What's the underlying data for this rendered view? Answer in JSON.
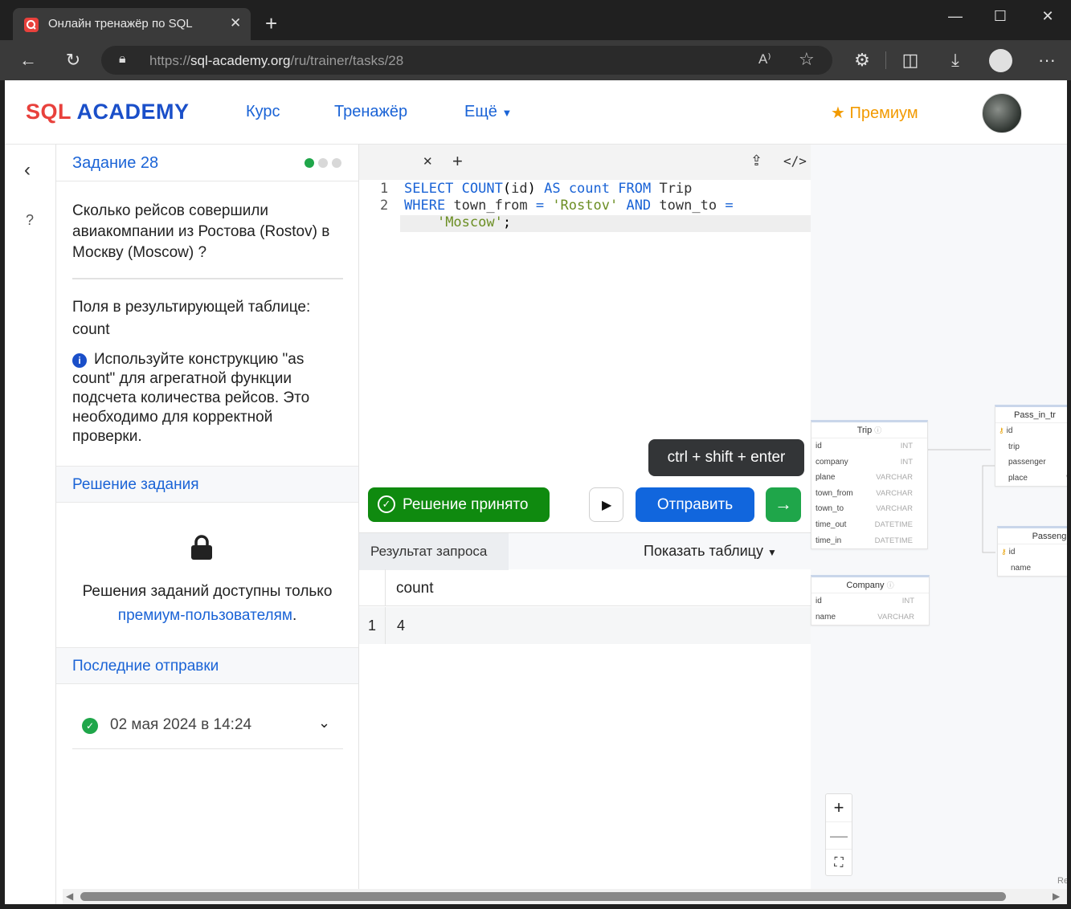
{
  "browser": {
    "tab_title": "Онлайн тренажёр по SQL",
    "url_prefix": "https://",
    "url_host": "sql-academy.org",
    "url_path": "/ru/trainer/tasks/28"
  },
  "header": {
    "logo_sql": "SQL",
    "logo_academy": "ACADEMY",
    "nav": [
      "Курс",
      "Тренажёр",
      "Ещё"
    ],
    "premium": "Премиум"
  },
  "rail": {
    "help": "?"
  },
  "task": {
    "title": "Задание 28",
    "question": "Сколько рейсов совершили авиакомпании из Ростова (Rostov) в Москву (Moscow) ?",
    "fields_label": "Поля в результирующей таблице:",
    "fields_value": "count",
    "hint": "Используйте конструкцию \"as count\" для агрегатной функции подсчета количества рейсов. Это необходимо для корректной проверки.",
    "solution_head": "Решение задания",
    "locked_text": "Решения заданий доступны только",
    "locked_link": "премиум-пользователям",
    "locked_dot": ".",
    "recent_head": "Последние отправки",
    "submission_date": "02 мая 2024 в 14:24"
  },
  "editor": {
    "line_numbers": [
      "1",
      "2"
    ],
    "tooltip": "ctrl + shift + enter",
    "accepted_label": "Решение принято",
    "send_label": "Отправить",
    "result_tab": "Результат запроса",
    "show_table": "Показать таблицу",
    "result_columns": [
      "count"
    ],
    "result_rows": [
      [
        "1",
        "4"
      ]
    ]
  },
  "schema": {
    "tables": [
      {
        "name": "Trip",
        "rows": [
          [
            "id",
            "INT"
          ],
          [
            "company",
            "INT"
          ],
          [
            "plane",
            "VARCHAR"
          ],
          [
            "town_from",
            "VARCHAR"
          ],
          [
            "town_to",
            "VARCHAR"
          ],
          [
            "time_out",
            "DATETIME"
          ],
          [
            "time_in",
            "DATETIME"
          ]
        ]
      },
      {
        "name": "Company",
        "rows": [
          [
            "id",
            "INT"
          ],
          [
            "name",
            "VARCHAR"
          ]
        ]
      },
      {
        "name": "Pass_in_tr",
        "rows": [
          [
            "id",
            ""
          ],
          [
            "trip",
            ""
          ],
          [
            "passenger",
            ""
          ],
          [
            "place",
            "V"
          ]
        ]
      },
      {
        "name": "Passeng",
        "rows": [
          [
            "id",
            ""
          ],
          [
            "name",
            ""
          ]
        ]
      }
    ],
    "watermark": "Re"
  },
  "colors": {
    "accent": "#1a63d6",
    "success": "#0f8a0f",
    "premium": "#f29a00",
    "logo_red": "#e8413c"
  }
}
